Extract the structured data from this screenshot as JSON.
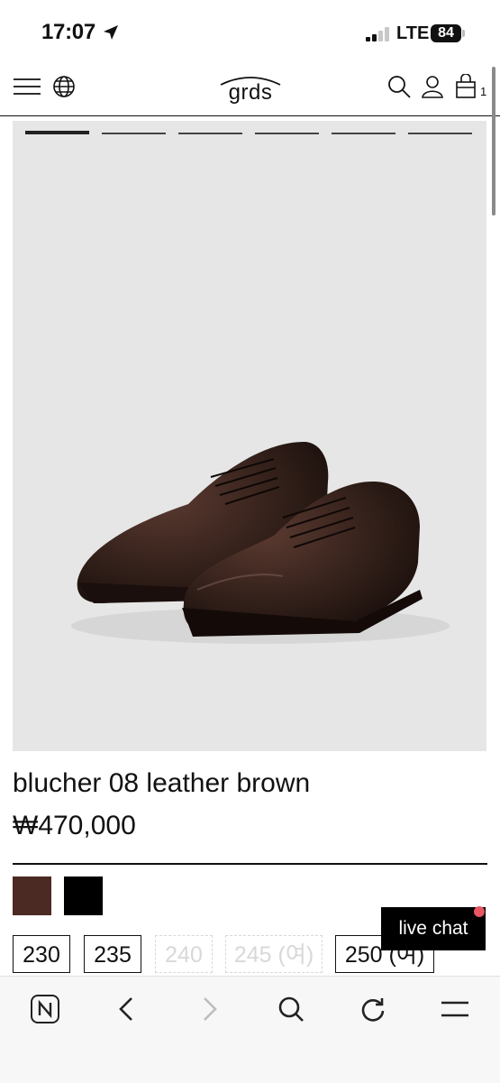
{
  "status_bar": {
    "time": "17:07",
    "network": "LTE",
    "battery": "84"
  },
  "header": {
    "logo": "grds",
    "cart_count": "1"
  },
  "gallery": {
    "slide_count": 6,
    "active_slide": 1
  },
  "product": {
    "name": "blucher 08 leather brown",
    "price": "₩470,000",
    "colors": [
      {
        "name": "brown",
        "hex": "#4a2a22"
      },
      {
        "name": "black",
        "hex": "#000000"
      }
    ],
    "sizes": [
      {
        "label": "230",
        "available": true
      },
      {
        "label": "235",
        "available": true
      },
      {
        "label": "240",
        "available": false
      },
      {
        "label": "245 (여)",
        "available": false
      },
      {
        "label": "250 (여)",
        "available": true
      }
    ]
  },
  "live_chat": {
    "label": "live chat"
  }
}
